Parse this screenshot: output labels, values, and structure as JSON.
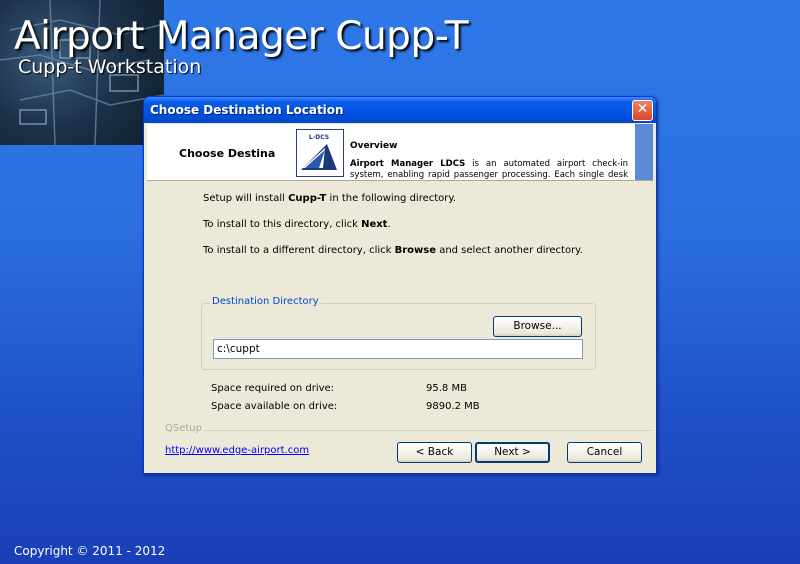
{
  "app": {
    "title": "Airport Manager Cupp-T",
    "subtitle": "Cupp-t Workstation",
    "copyright": "Copyright © 2011 - 2012"
  },
  "dialog": {
    "title": "Choose Destination Location",
    "close_label": "✕",
    "header": {
      "heading": "Choose Destina",
      "overview_title": "Overview",
      "overview_strong": "Airport Manager LDCS",
      "overview_text": " is an automated airport check-in system, enabling rapid passenger processing. Each single desk can handle",
      "logo_text": "L-DCS"
    },
    "body": {
      "line1_prefix": "Setup will install ",
      "line1_strong": "Cupp-T",
      "line1_suffix": " in the following directory.",
      "line2_prefix": "To install to this directory, click ",
      "line2_strong": "Next",
      "line2_suffix": ".",
      "line3_prefix": "To install to a different directory, click ",
      "line3_strong": "Browse",
      "line3_suffix": " and select another directory."
    },
    "destination": {
      "legend": "Destination Directory",
      "browse_label": "Browse...",
      "path_value": "c:\\cuppt"
    },
    "space": {
      "required_label": "Space required on drive:",
      "required_value": "95.8 MB",
      "available_label": "Space available on drive:",
      "available_value": "9890.2 MB"
    },
    "footer": {
      "group_label": "QSetup",
      "link": "http://www.edge-airport.com",
      "back_label": "< Back",
      "next_label": "Next >",
      "cancel_label": "Cancel"
    }
  }
}
